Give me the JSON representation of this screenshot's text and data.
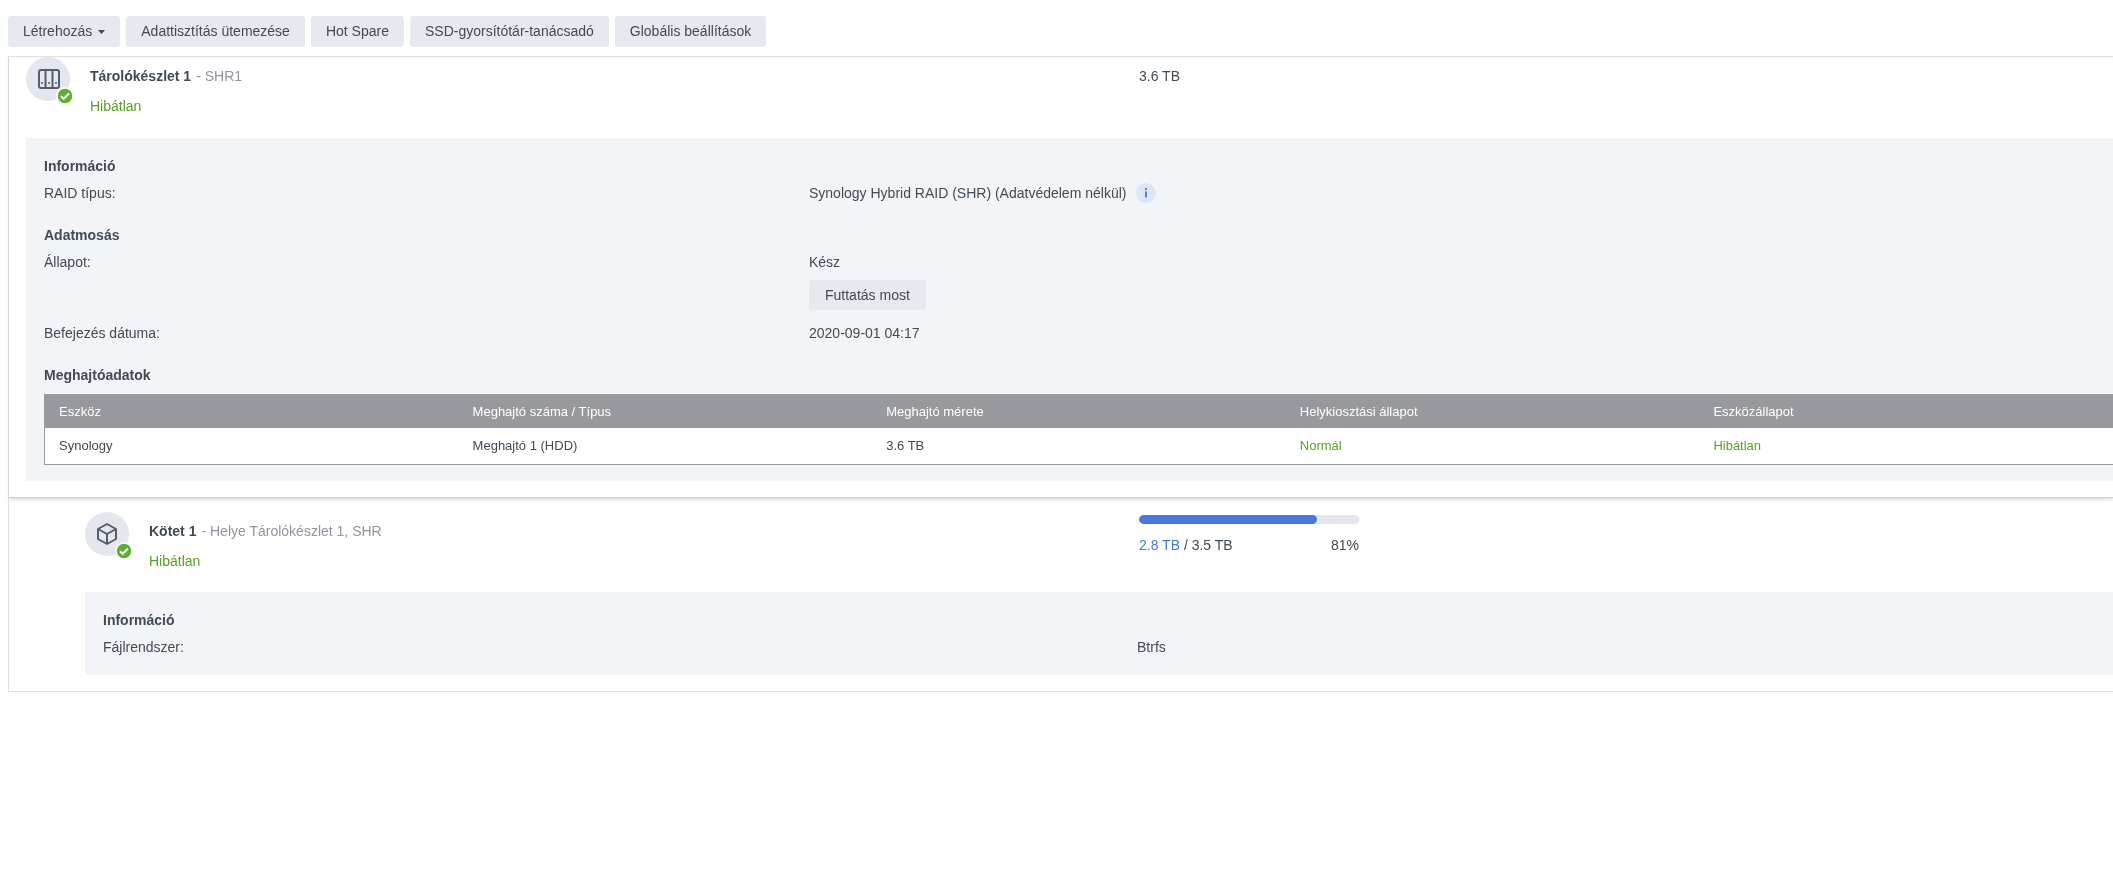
{
  "toolbar": [
    {
      "label": "Létrehozás",
      "kind": "dropdown"
    },
    {
      "label": "Adattisztítás ütemezése",
      "kind": "button"
    },
    {
      "label": "Hot Spare",
      "kind": "button"
    },
    {
      "label": "SSD-gyorsítótár-tanácsadó",
      "kind": "button"
    },
    {
      "label": "Globális beállítások",
      "kind": "button"
    }
  ],
  "pool": {
    "title": "Tárolókészlet 1",
    "subtitle": "- SHR1",
    "status": "Hibátlan",
    "healthy": true,
    "capacity": "3.6 TB",
    "sections": [
      {
        "heading": "Információ",
        "rows": [
          {
            "label": "RAID típus:",
            "value": "Synology Hybrid RAID (SHR) (Adatvédelem nélkül)",
            "kind": "info"
          }
        ]
      },
      {
        "heading": "Adatmosás",
        "rows": [
          {
            "label": "Állapot:",
            "value": "Kész",
            "kind": "action",
            "action": "Futtatás most"
          },
          {
            "label": "Befejezés dátuma:",
            "value": "2020-09-01 04:17",
            "kind": "text"
          }
        ]
      }
    ],
    "drives": {
      "heading": "Meghajtóadatok",
      "columns": [
        "Eszköz",
        "Meghajtó száma / Típus",
        "Meghajtó mérete",
        "Helykiosztási állapot",
        "Eszközállapot"
      ],
      "rows": [
        {
          "cells": [
            "Synology",
            "Meghajtó 1 (HDD)",
            "3.6 TB",
            "Normál",
            "Hibátlan"
          ]
        }
      ]
    }
  },
  "volume": {
    "title": "Kötet 1",
    "subtitle": "- Helye Tárolókészlet 1, SHR",
    "status": "Hibátlan",
    "healthy": true,
    "used": "2.8 TB",
    "total": "/ 3.5 TB",
    "percent": "81%",
    "level": 0.81,
    "sections": [
      {
        "heading": "Információ",
        "rows": [
          {
            "label": "Fájlrendszer:",
            "value": "Btrfs",
            "kind": "text"
          }
        ]
      }
    ]
  }
}
